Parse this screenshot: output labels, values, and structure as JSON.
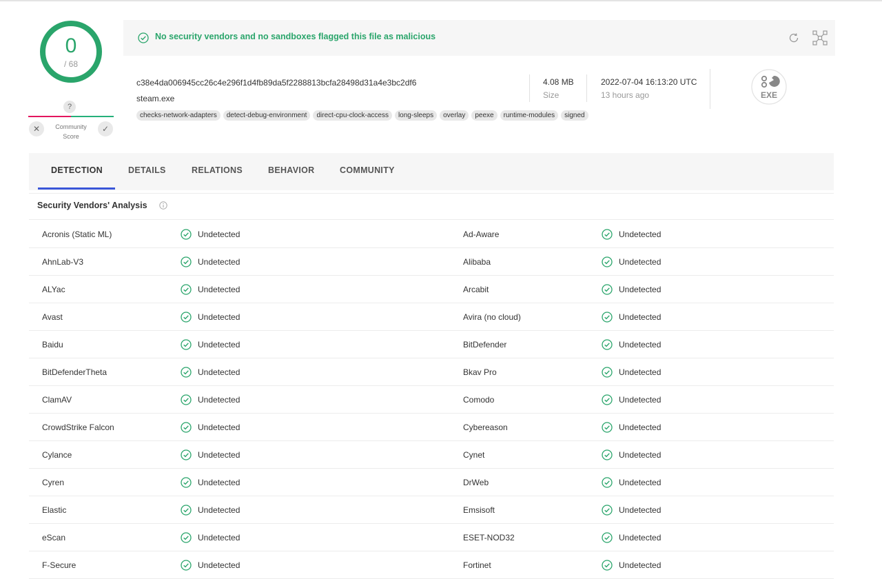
{
  "score": {
    "detected": "0",
    "total": "/ 68"
  },
  "community": {
    "question": "?",
    "label_line1": "Community",
    "label_line2": "Score"
  },
  "banner": {
    "message": "No security vendors and no sandboxes flagged this file as malicious"
  },
  "file": {
    "hash": "c38e4da006945cc26c4e296f1d4fb89da5f2288813bcfa28498d31a4e3bc2df6",
    "name": "steam.exe",
    "tags": [
      "checks-network-adapters",
      "detect-debug-environment",
      "direct-cpu-clock-access",
      "long-sleeps",
      "overlay",
      "peexe",
      "runtime-modules",
      "signed"
    ],
    "size_value": "4.08 MB",
    "size_label": "Size",
    "date_value": "2022-07-04 16:13:20 UTC",
    "date_relative": "13 hours ago",
    "type_label": "EXE"
  },
  "tabs": [
    {
      "label": "DETECTION",
      "active": true
    },
    {
      "label": "DETAILS",
      "active": false
    },
    {
      "label": "RELATIONS",
      "active": false
    },
    {
      "label": "BEHAVIOR",
      "active": false
    },
    {
      "label": "COMMUNITY",
      "active": false
    }
  ],
  "section": {
    "title": "Security Vendors' Analysis"
  },
  "vendors": [
    {
      "left": "Acronis (Static ML)",
      "right": "Ad-Aware"
    },
    {
      "left": "AhnLab-V3",
      "right": "Alibaba"
    },
    {
      "left": "ALYac",
      "right": "Arcabit"
    },
    {
      "left": "Avast",
      "right": "Avira (no cloud)"
    },
    {
      "left": "Baidu",
      "right": "BitDefender"
    },
    {
      "left": "BitDefenderTheta",
      "right": "Bkav Pro"
    },
    {
      "left": "ClamAV",
      "right": "Comodo"
    },
    {
      "left": "CrowdStrike Falcon",
      "right": "Cybereason"
    },
    {
      "left": "Cylance",
      "right": "Cynet"
    },
    {
      "left": "Cyren",
      "right": "DrWeb"
    },
    {
      "left": "Elastic",
      "right": "Emsisoft"
    },
    {
      "left": "eScan",
      "right": "ESET-NOD32"
    },
    {
      "left": "F-Secure",
      "right": "Fortinet"
    }
  ],
  "result_label": "Undetected",
  "colors": {
    "accent_green": "#2aa56b",
    "tab_underline": "#3a56d8",
    "malicious_red": "#e3155e"
  }
}
